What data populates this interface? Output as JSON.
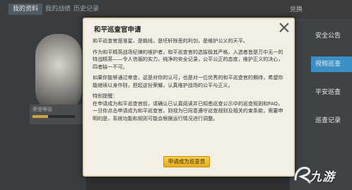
{
  "background": {
    "tabs": [
      "我的资料",
      "我的战绩",
      "历史记录"
    ],
    "top_right": "兑换",
    "level_label": "荣誉等级",
    "side_menu": [
      {
        "label": "安全公告",
        "active": false
      },
      {
        "label": "视频巡查",
        "active": true
      },
      {
        "label": "平安巡查",
        "active": false
      },
      {
        "label": "巡查记录",
        "active": false
      }
    ]
  },
  "dialog": {
    "title": "和平巡查官申请",
    "paragraph1": "和平巡查官是准星，是戟线，是坯轩除恶的利剑，是维护公义的天平。",
    "paragraph2": "作为和平精英战场纪律的维护者，和平巡查官的选拔极其严格，入选者皆是万中无一的特战精英——令人信服的实力，纯净的安全记录，公平公正的态度，维护正义的决心，四者缺一不可。",
    "paragraph3": "如果你能够通过审查，这是对你的认可，也是对一位优秀的和平巡查官的期待，希望你能继续以身作则，担起这份荣耀，认真维护战场的公平与正义。",
    "note_title": "特别提醒：",
    "paragraph4": "在申请成为和平巡查官前，请确认已认真阅读并已知悉巡查公示中的巡查规则和FAQ，一旦你点击申请成为和平巡查官，则视为已同意遵守巡查规则及相关约束条款，需要申明的是，系统功能和规则可能会根据运行情况进行调整。",
    "apply_button": "申请成为巡查员"
  },
  "watermark": {
    "text": "九游"
  },
  "colors": {
    "dialog_bg": "#f3efe4",
    "button_gold": "#f0be2e",
    "active_blue": "#3a8fc4"
  }
}
